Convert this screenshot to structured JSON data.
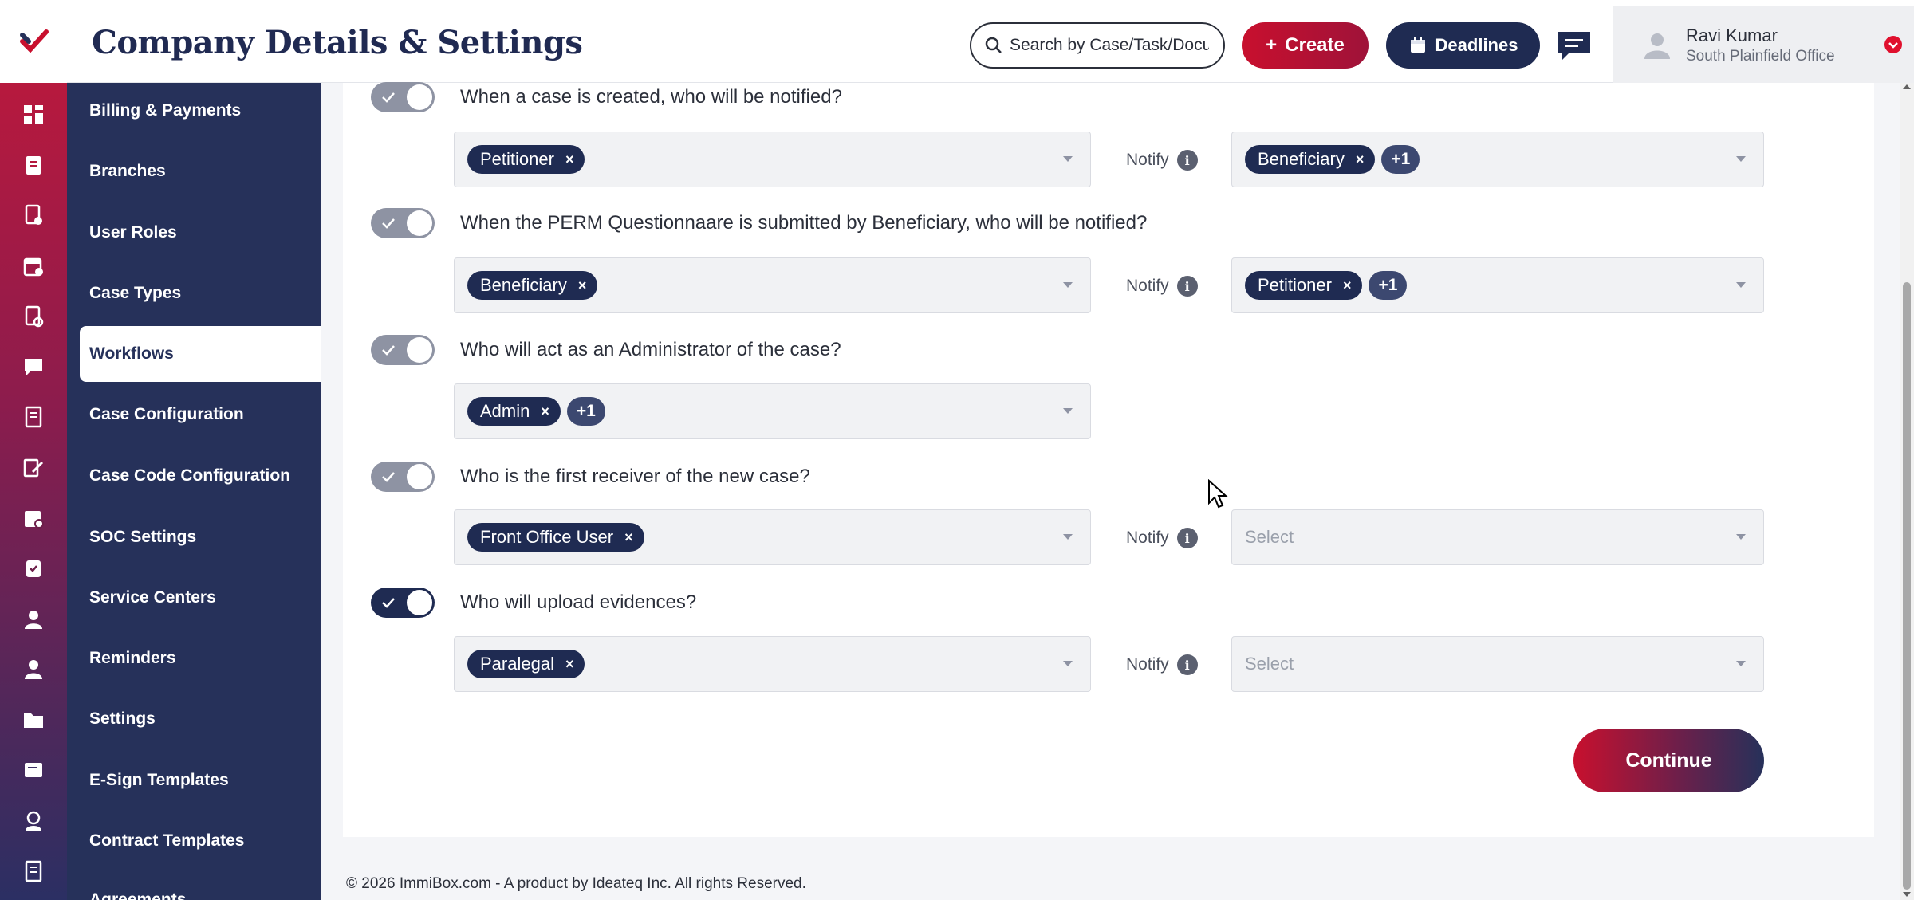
{
  "header": {
    "title": "Company Details & Settings",
    "search_placeholder": "Search by Case/Task/Document",
    "create_label": "Create",
    "deadlines_label": "Deadlines",
    "user": {
      "name": "Ravi Kumar",
      "office": "South Plainfield Office"
    }
  },
  "sidebar": {
    "items": [
      {
        "label": "Billing & Payments"
      },
      {
        "label": "Branches"
      },
      {
        "label": "User Roles"
      },
      {
        "label": "Case Types"
      },
      {
        "label": "Workflows",
        "active": true
      },
      {
        "label": "Case Configuration"
      },
      {
        "label": "Case Code Configuration"
      },
      {
        "label": "SOC Settings"
      },
      {
        "label": "Service Centers"
      },
      {
        "label": "Reminders"
      },
      {
        "label": "Settings"
      },
      {
        "label": "E-Sign Templates"
      },
      {
        "label": "Contract Templates"
      },
      {
        "label": "Agreements"
      }
    ],
    "rail_icons": [
      "dashboard-icon",
      "clipboard-icon",
      "document-icon",
      "calendar-icon",
      "form-icon",
      "chat-icon",
      "receipt-icon",
      "edit-icon",
      "badge-icon",
      "clipboard-check-icon",
      "person-icon",
      "user-tie-icon",
      "folder-icon",
      "note-icon",
      "support-agent-icon",
      "report-icon"
    ]
  },
  "workflow": {
    "notify_label": "Notify",
    "rows": [
      {
        "question": "When a case is created, who will be notified?",
        "enabled": false,
        "selected": [
          "Petitioner"
        ],
        "selected_more": "",
        "notify": [
          "Beneficiary"
        ],
        "notify_more": "+1",
        "notify_placeholder": ""
      },
      {
        "question": "When the PERM Questionnaare is submitted by Beneficiary, who will be notified?",
        "enabled": false,
        "selected": [
          "Beneficiary"
        ],
        "selected_more": "",
        "notify": [
          "Petitioner"
        ],
        "notify_more": "+1",
        "notify_placeholder": ""
      },
      {
        "question": "Who will act as an Administrator of the case?",
        "enabled": false,
        "selected": [
          "Admin"
        ],
        "selected_more": "+1",
        "notify": null
      },
      {
        "question": "Who is the first receiver of the new case?",
        "enabled": false,
        "selected": [
          "Front Office User"
        ],
        "selected_more": "",
        "notify": [],
        "notify_more": "",
        "notify_placeholder": "Select"
      },
      {
        "question": "Who will upload evidences?",
        "enabled": true,
        "selected": [
          "Paralegal"
        ],
        "selected_more": "",
        "notify": [],
        "notify_more": "",
        "notify_placeholder": "Select"
      }
    ],
    "continue_label": "Continue"
  },
  "footer": {
    "text": "© 2026 ImmiBox.com - A product by Ideateq Inc. All rights Reserved."
  },
  "colors": {
    "brand_red": "#c8102e",
    "navy": "#26315a",
    "chip": "#1f2b52"
  }
}
